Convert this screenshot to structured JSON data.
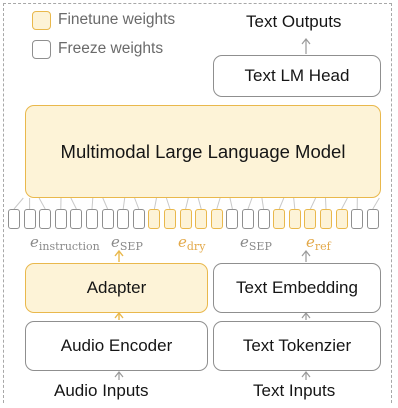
{
  "legend": {
    "finetune": "Finetune weights",
    "freeze": "Freeze weights"
  },
  "outputs_label": "Text Outputs",
  "boxes": {
    "text_lm_head": "Text LM Head",
    "mllm": "Multimodal Large Language Model",
    "adapter": "Adapter",
    "text_embedding": "Text Embedding",
    "audio_encoder": "Audio Encoder",
    "text_tokenizer": "Text Tokenzier"
  },
  "inputs": {
    "audio": "Audio Inputs",
    "text": "Text Inputs"
  },
  "tokens": {
    "instruction": {
      "base": "e",
      "sub": "instruction"
    },
    "sep1": {
      "base": "e",
      "sub": "SEP"
    },
    "dry": {
      "base": "e",
      "sub": "dry"
    },
    "sep2": {
      "base": "e",
      "sub": "SEP"
    },
    "ref": {
      "base": "e",
      "sub": "ref"
    }
  },
  "colors": {
    "finetune_fill": "#fdf3d7",
    "finetune_border": "#e9b84c",
    "freeze_border": "#8f8f8f",
    "token_label_gray": "#8a8a8a",
    "token_label_orange": "#e3a94a"
  }
}
